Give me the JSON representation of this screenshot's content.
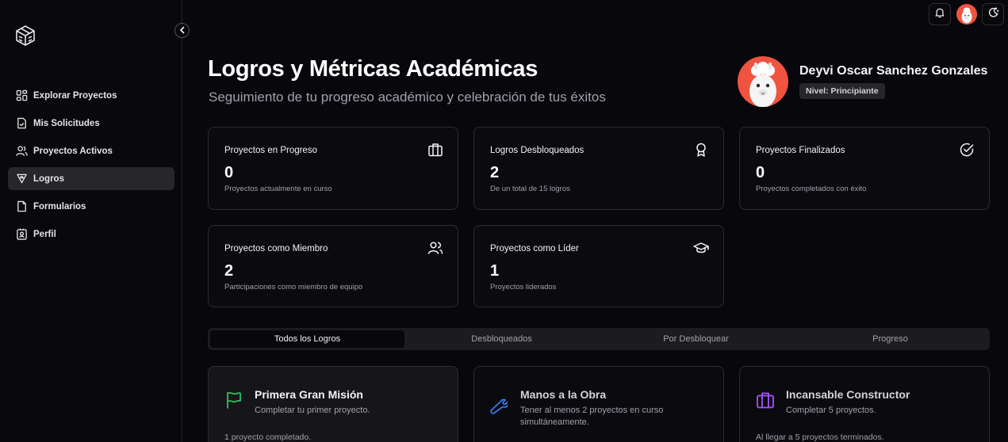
{
  "sidebar": {
    "items": [
      {
        "label": "Explorar Proyectos",
        "icon": "grid-icon"
      },
      {
        "label": "Mis Solicitudes",
        "icon": "document-check-icon"
      },
      {
        "label": "Proyectos Activos",
        "icon": "users-icon"
      },
      {
        "label": "Logros",
        "icon": "trophy-icon",
        "active": true
      },
      {
        "label": "Formularios",
        "icon": "file-icon"
      },
      {
        "label": "Perfil",
        "icon": "contact-card-icon"
      }
    ]
  },
  "header": {
    "title": "Logros y Métricas Académicas",
    "subtitle": "Seguimiento de tu progreso académico y celebración de tus éxitos"
  },
  "profile": {
    "name": "Deyvi Oscar Sanchez Gonzales",
    "level": "Nivel: Principiante"
  },
  "stats": [
    {
      "label": "Proyectos en Progreso",
      "value": "0",
      "desc": "Proyectos actualmente en curso",
      "icon": "briefcase-icon"
    },
    {
      "label": "Logros Desbloqueados",
      "value": "2",
      "desc": "De un total de 15 logros",
      "icon": "award-icon"
    },
    {
      "label": "Proyectos Finalizados",
      "value": "0",
      "desc": "Proyectos completados con éxito",
      "icon": "check-circle-icon"
    },
    {
      "label": "Proyectos como Miembro",
      "value": "2",
      "desc": "Participaciones como miembro de equipo",
      "icon": "users-icon"
    },
    {
      "label": "Proyectos como Líder",
      "value": "1",
      "desc": "Proyectos liderados",
      "icon": "graduation-cap-icon"
    }
  ],
  "tabs": [
    {
      "label": "Todos los Logros",
      "active": true
    },
    {
      "label": "Desbloqueados"
    },
    {
      "label": "Por Desbloquear"
    },
    {
      "label": "Progreso"
    }
  ],
  "achievements": [
    {
      "title": "Primera Gran Misión",
      "desc": "Completar tu primer proyecto.",
      "footer": "1 proyecto completado.",
      "icon": "flag-icon",
      "color": "#22c55e",
      "unlocked": true
    },
    {
      "title": "Manos a la Obra",
      "desc": "Tener al menos 2 proyectos en curso simultáneamente.",
      "footer": "",
      "icon": "wrench-icon",
      "color": "#3b82f6",
      "unlocked": false
    },
    {
      "title": "Incansable Constructor",
      "desc": "Completar 5 proyectos.",
      "footer": "Al llegar a 5 proyectos terminados.",
      "icon": "briefcase-icon",
      "color": "#a855f7",
      "unlocked": false
    }
  ],
  "colors": {
    "background": "#08070c",
    "card_border": "#2b2b30",
    "active_nav": "#27272a",
    "muted_text": "#a1a1aa"
  }
}
